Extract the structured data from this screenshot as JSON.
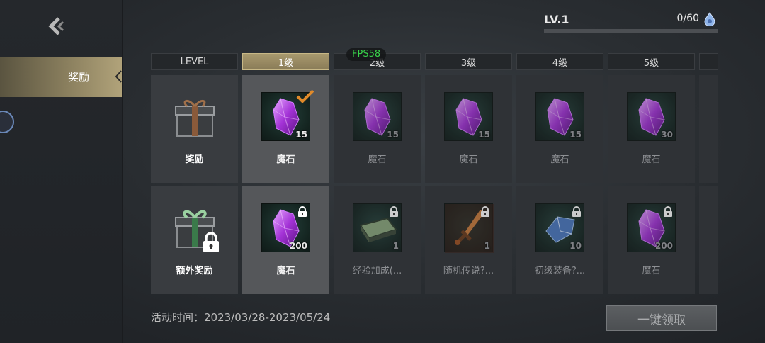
{
  "side": {
    "tab_label": "奖励"
  },
  "level": {
    "label": "LV.1",
    "exp_text": "0/60",
    "exp_progress": 0
  },
  "fps": "FPS58",
  "table": {
    "headers": [
      "LEVEL",
      "1级",
      "2级",
      "3级",
      "4级",
      "5级"
    ],
    "active_column": 1,
    "rows": [
      {
        "head_label": "奖励",
        "head_icon": "gift-box-icon",
        "items": [
          {
            "name": "魔石",
            "qty": "15",
            "icon": "magic-stone-icon",
            "claimed": true
          },
          {
            "name": "魔石",
            "qty": "15",
            "icon": "magic-stone-icon"
          },
          {
            "name": "魔石",
            "qty": "15",
            "icon": "magic-stone-icon"
          },
          {
            "name": "魔石",
            "qty": "15",
            "icon": "magic-stone-icon"
          },
          {
            "name": "魔石",
            "qty": "30",
            "icon": "magic-stone-icon"
          }
        ]
      },
      {
        "head_label": "额外奖励",
        "head_icon": "locked-gift-box-icon",
        "items": [
          {
            "name": "魔石",
            "qty": "200",
            "icon": "magic-stone-icon",
            "locked": true
          },
          {
            "name": "经验加成(...",
            "qty": "1",
            "icon": "exp-book-icon",
            "locked": true
          },
          {
            "name": "随机传说?...",
            "qty": "1",
            "icon": "legend-dagger-icon",
            "locked": true
          },
          {
            "name": "初级装备?...",
            "qty": "10",
            "icon": "blue-crystal-icon",
            "locked": true
          },
          {
            "name": "魔石",
            "qty": "200",
            "icon": "magic-stone-icon",
            "locked": true
          }
        ]
      }
    ]
  },
  "footer": {
    "event_time": "活动时间：2023/03/28-2023/05/24",
    "claim_all_label": "一键领取"
  },
  "colors": {
    "accent_gold": "#a8996e",
    "check_orange": "#e08a2a",
    "fps_green": "#38d24a"
  }
}
